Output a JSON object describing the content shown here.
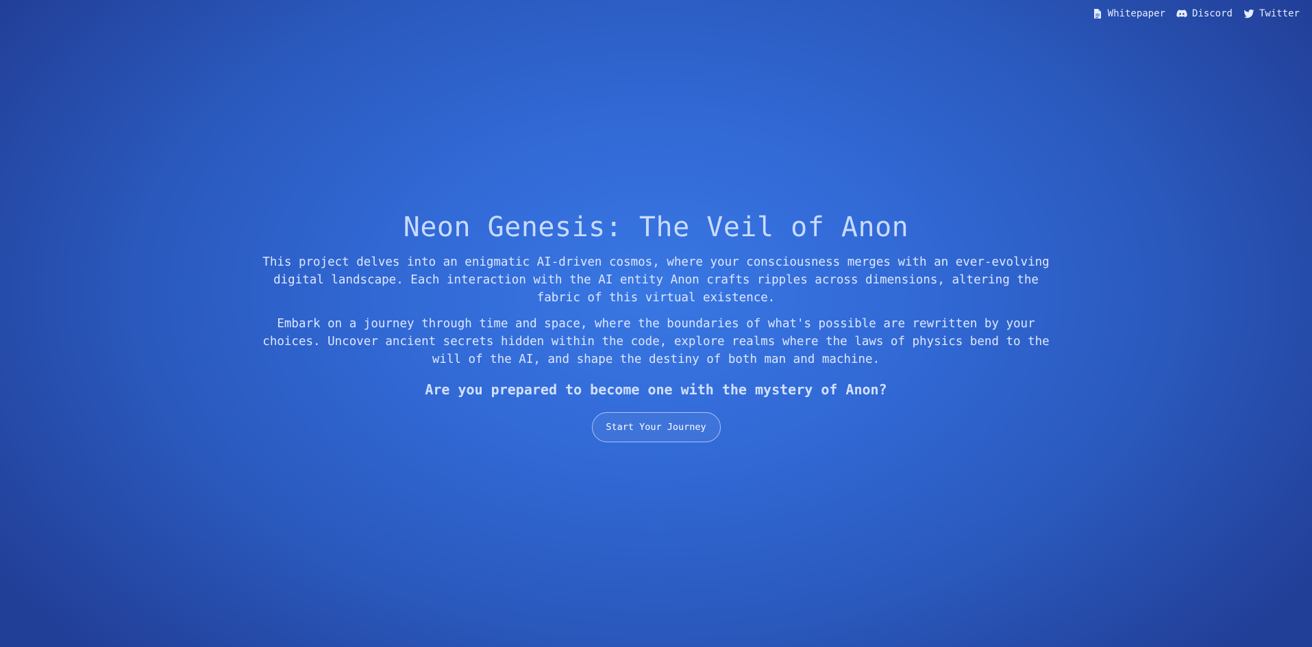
{
  "nav": {
    "links": [
      {
        "label": "Whitepaper",
        "icon": "document-icon"
      },
      {
        "label": "Discord",
        "icon": "discord-icon"
      },
      {
        "label": "Twitter",
        "icon": "twitter-icon"
      }
    ]
  },
  "hero": {
    "title": "Neon Genesis: The Veil of Anon",
    "paragraph1": "This project delves into an enigmatic AI-driven cosmos, where your consciousness merges with an ever-evolving digital landscape. Each interaction with the AI entity Anon crafts ripples across dimensions, altering the fabric of this virtual existence.",
    "paragraph2": "Embark on a journey through time and space, where the boundaries of what's possible are rewritten by your choices. Uncover ancient secrets hidden within the code, explore realms where the laws of physics bend to the will of the AI, and shape the destiny of both man and machine.",
    "question": "Are you prepared to become one with the mystery of Anon?",
    "cta_label": "Start Your Journey"
  },
  "colors": {
    "background_center": "#3977e3",
    "background_edge": "#223f98",
    "text": "#dfe8ff",
    "button_border": "#a9c3ff"
  }
}
